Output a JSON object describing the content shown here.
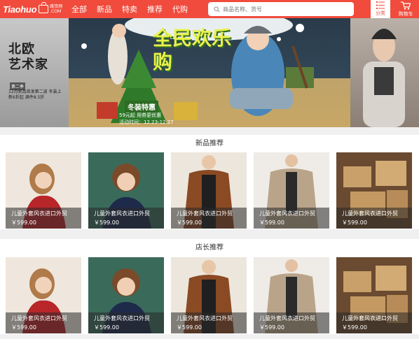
{
  "app": {
    "logo_text": "Tiaohuo",
    "logo_sub": "跳货网",
    "logo_domain": ".COM"
  },
  "nav": [
    {
      "label": "全部"
    },
    {
      "label": "新品"
    },
    {
      "label": "特卖"
    },
    {
      "label": "推荐"
    },
    {
      "label": "代购"
    }
  ],
  "search": {
    "placeholder": "商品名称、货号",
    "icon": "search-icon"
  },
  "header_buttons": {
    "category_label": "分类",
    "category_icon": "list-icon",
    "cart_label": "购物车",
    "cart_icon": "cart-icon"
  },
  "banner": {
    "left_title1": "北欧",
    "left_title2": "艺术家",
    "left_tag": "第二季",
    "left_text": "12月新品首发第二波 冬装上新6折起 满件8.5折",
    "main_title": "全民欢乐购",
    "promo_label": "冬装特惠",
    "promo_sub": "59元起 用券更优惠",
    "promo_time": "活动时间：12.23-12.27"
  },
  "sections": [
    {
      "title": "新品推荐",
      "products": [
        {
          "name": "儿童外套风衣进口外贸",
          "price": "￥599.00",
          "image": "girl-red-coat"
        },
        {
          "name": "儿童外套风衣进口外贸",
          "price": "￥599.00",
          "image": "boy-navy-coat"
        },
        {
          "name": "儿童外套风衣进口外贸",
          "price": "￥599.00",
          "image": "woman-brown-coat"
        },
        {
          "name": "儿童外套风衣进口外贸",
          "price": "￥599.00",
          "image": "man-beige-coat"
        },
        {
          "name": "儿童外套风衣进口外贸",
          "price": "￥599.00",
          "image": "gift-boxes"
        }
      ]
    },
    {
      "title": "店长推荐",
      "products": [
        {
          "name": "儿童外套风衣进口外贸",
          "price": "￥599.00",
          "image": "girl-red-coat"
        },
        {
          "name": "儿童外套风衣进口外贸",
          "price": "￥599.00",
          "image": "boy-navy-coat"
        },
        {
          "name": "儿童外套风衣进口外贸",
          "price": "￥599.00",
          "image": "woman-brown-coat"
        },
        {
          "name": "儿童外套风衣进口外贸",
          "price": "￥599.00",
          "image": "man-beige-coat"
        },
        {
          "name": "儿童外套风衣进口外贸",
          "price": "￥599.00",
          "image": "gift-boxes"
        }
      ]
    }
  ],
  "colors": {
    "brand": "#f04b3c",
    "caption_overlay": "#282828"
  }
}
